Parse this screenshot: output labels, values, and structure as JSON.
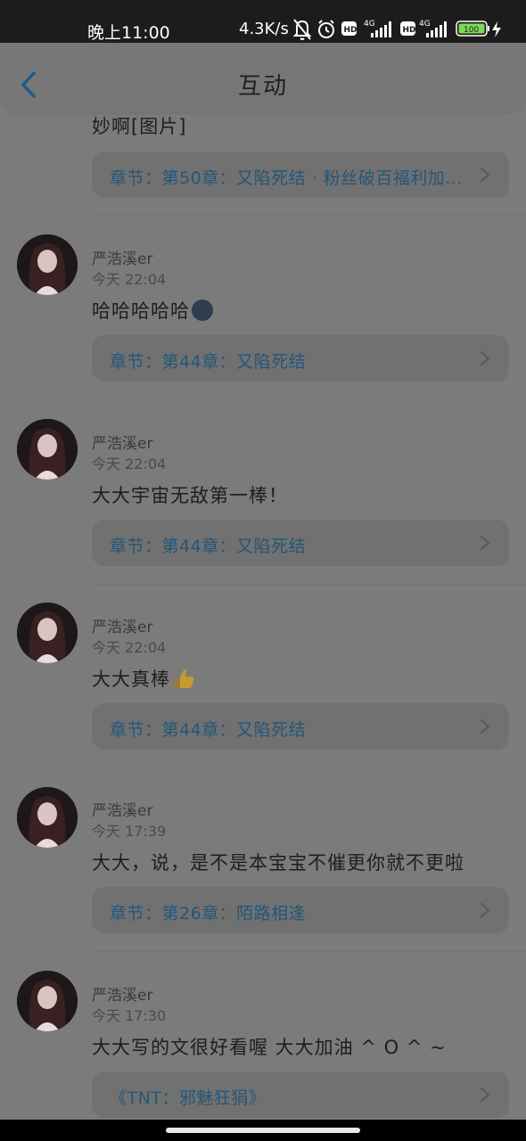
{
  "status_bar": {
    "time": "晚上11:00",
    "network_speed": "4.3K/s",
    "icons": [
      "bell-muted-icon",
      "alarm-icon",
      "hd-icon",
      "signal-4g-icon",
      "hd-icon",
      "signal-4g-icon",
      "battery-icon",
      "charging-icon"
    ],
    "battery_label": "100"
  },
  "header": {
    "back_icon": "chevron-left-icon",
    "title": "互动",
    "accent_color": "#1a5b8c"
  },
  "top_partial": {
    "message": "妙啊[图片]",
    "chapter_label": "章节：第50章：又陷死结 · 粉丝破百福利加..."
  },
  "comments": [
    {
      "user": "严浩溪er",
      "time": "今天 22:04",
      "message": "哈哈哈哈哈",
      "emoji": "moon-face-emoji",
      "chapter_label": "章节：第44章：又陷死结"
    },
    {
      "user": "严浩溪er",
      "time": "今天 22:04",
      "message": "大大宇宙无敌第一棒！",
      "emoji": "",
      "chapter_label": "章节：第44章：又陷死结"
    },
    {
      "user": "严浩溪er",
      "time": "今天 22:04",
      "message": "大大真棒",
      "emoji": "thumbs-up-emoji",
      "chapter_label": "章节：第44章：又陷死结"
    },
    {
      "user": "严浩溪er",
      "time": "今天 17:39",
      "message": "大大，说，是不是本宝宝不催更你就不更啦",
      "emoji": "",
      "chapter_label": "章节：第26章：陌路相逢"
    },
    {
      "user": "严浩溪er",
      "time": "今天 17:30",
      "message": "大大写的文很好看喔 大大加油 ^ O ^ ~",
      "emoji": "",
      "chapter_label": "《TNT：邪魅狂狷》"
    }
  ]
}
